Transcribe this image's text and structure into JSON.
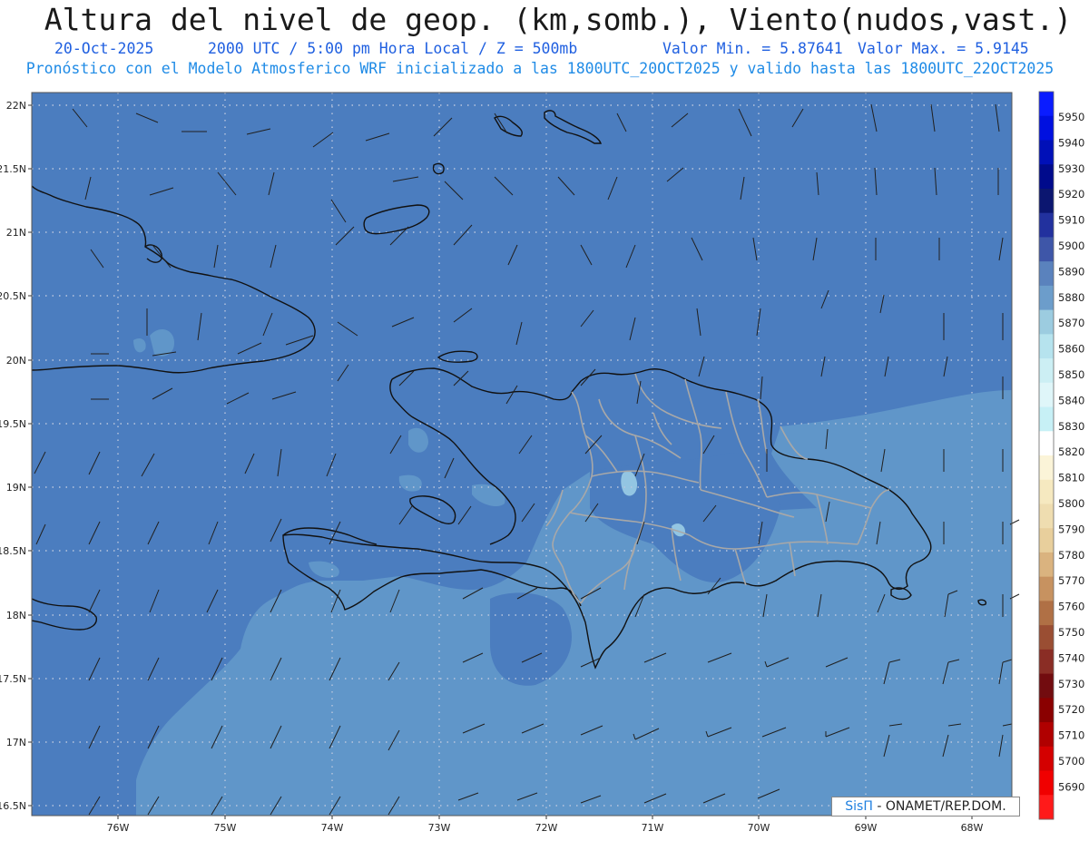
{
  "header": {
    "title": "Altura del nivel de geop. (km,somb.), Viento(nudos,vast.)",
    "date": "20-Oct-2025",
    "time": "2000 UTC / 5:00 pm Hora Local / Z = 500mb",
    "min": "Valor Min. = 5.87641",
    "max": "Valor Max. = 5.9145",
    "model_line": "Pronóstico con el Modelo Atmosferico WRF inicializado a las 1800UTC_20OCT2025 y valido hasta las  1800UTC_22OCT2025"
  },
  "lat_labels": [
    "22N",
    "21.5N",
    "21N",
    "20.5N",
    "20N",
    "19.5N",
    "19N",
    "18.5N",
    "18N",
    "17.5N",
    "17N",
    "16.5N"
  ],
  "lon_labels": [
    "76W",
    "75W",
    "74W",
    "73W",
    "72W",
    "71W",
    "70W",
    "69W",
    "68W"
  ],
  "colorbar": {
    "labels": [
      "5950",
      "5940",
      "5930",
      "5920",
      "5910",
      "5900",
      "5890",
      "5880",
      "5870",
      "5860",
      "5850",
      "5840",
      "5830",
      "5820",
      "5810",
      "5800",
      "5790",
      "5780",
      "5770",
      "5760",
      "5750",
      "5740",
      "5730",
      "5720",
      "5710",
      "5700",
      "5690"
    ],
    "colors": [
      "#0a1cff",
      "#0010e0",
      "#0010b8",
      "#000a8c",
      "#0b1670",
      "#22319e",
      "#3e56a8",
      "#5a82bd",
      "#6c9dcb",
      "#9ccce0",
      "#b6e3ee",
      "#cceff4",
      "#dff6f9",
      "#c7f0f6",
      "#ffffff",
      "#fbf4d8",
      "#f6e9c0",
      "#efddb0",
      "#e8cf9c",
      "#dab37f",
      "#c79260",
      "#b07045",
      "#9a4e33",
      "#8a2d25",
      "#720c0f",
      "#8a0000",
      "#b00000",
      "#d40000",
      "#f00000",
      "#ff1a1a"
    ]
  },
  "field": {
    "color_5890": "#4b7dbf",
    "color_5880": "#6096c9",
    "color_5870": "#93c5e2"
  },
  "credit": {
    "sis": "SisΠ",
    "org": "- ONAMET/REP.DOM."
  }
}
